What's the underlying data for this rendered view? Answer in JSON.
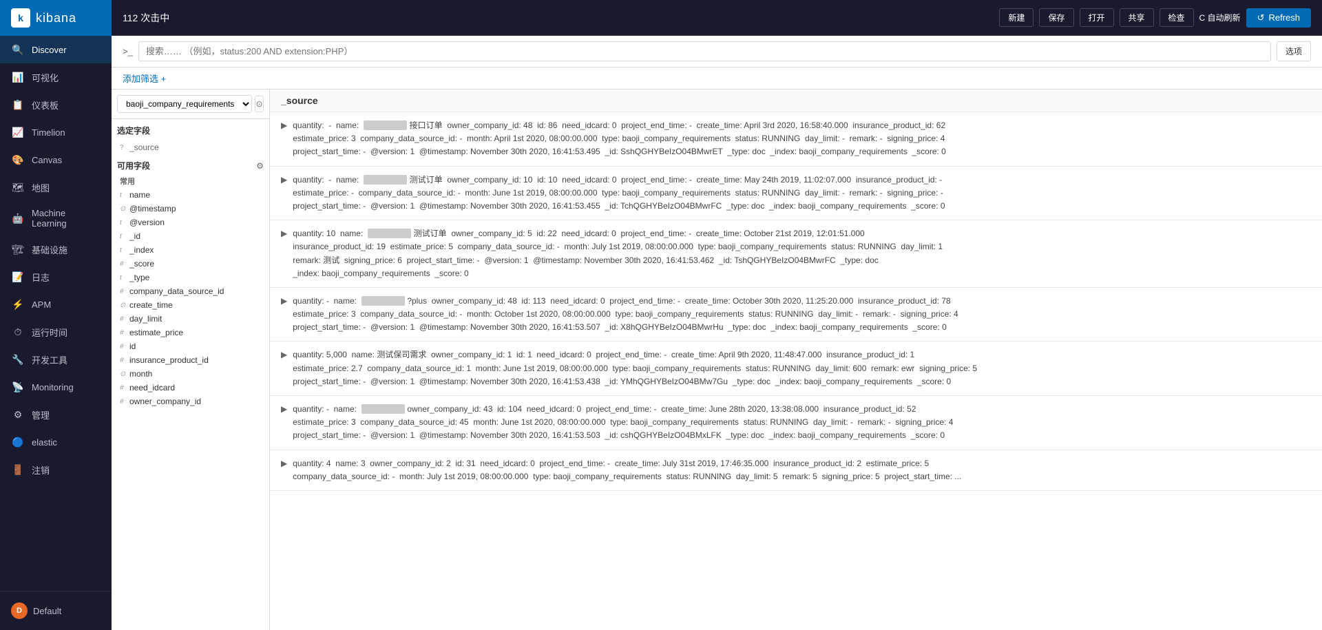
{
  "app": {
    "logo_text": "kibana",
    "logo_initial": "k"
  },
  "sidebar": {
    "items": [
      {
        "id": "discover",
        "label": "Discover",
        "icon": "🔍",
        "active": true
      },
      {
        "id": "visualize",
        "label": "可视化",
        "icon": "📊"
      },
      {
        "id": "dashboard",
        "label": "仪表板",
        "icon": "📋"
      },
      {
        "id": "timelion",
        "label": "Timelion",
        "icon": "📈"
      },
      {
        "id": "canvas",
        "label": "Canvas",
        "icon": "🎨"
      },
      {
        "id": "maps",
        "label": "地图",
        "icon": "🗺"
      },
      {
        "id": "ml",
        "label": "Machine Learning",
        "icon": "🤖"
      },
      {
        "id": "infra",
        "label": "基础设施",
        "icon": "🏗"
      },
      {
        "id": "logs",
        "label": "日志",
        "icon": "📝"
      },
      {
        "id": "apm",
        "label": "APM",
        "icon": "⚡"
      },
      {
        "id": "uptime",
        "label": "运行时间",
        "icon": "⏱"
      },
      {
        "id": "devtools",
        "label": "开发工具",
        "icon": "🔧"
      },
      {
        "id": "monitoring",
        "label": "Monitoring",
        "icon": "📡"
      },
      {
        "id": "management",
        "label": "管理",
        "icon": "⚙"
      },
      {
        "id": "elastic",
        "label": "elastic",
        "icon": "🔵"
      }
    ],
    "bottom_item": {
      "label": "注销",
      "icon": "🚪"
    },
    "user": {
      "label": "Default",
      "initial": "D"
    }
  },
  "topbar": {
    "hit_count": "112 次击中",
    "btn_new": "新建",
    "btn_save": "保存",
    "btn_open": "打开",
    "btn_share": "共享",
    "btn_inspect": "检查",
    "btn_autorefresh": "C 自动刷新",
    "btn_refresh": "Refresh"
  },
  "searchbar": {
    "prompt": ">_",
    "placeholder": "搜索…… （例如，status:200 AND extension:PHP）",
    "btn_options": "选项"
  },
  "filterbar": {
    "add_filter_label": "添加筛选 +"
  },
  "left_panel": {
    "index_pattern": "baoji_company_requirements",
    "selected_fields_label": "选定字段",
    "source_field": "_source",
    "available_fields_label": "可用字段",
    "categories": [
      {
        "label": "常用",
        "fields": [
          {
            "type": "t",
            "name": "name"
          },
          {
            "type": "⊙",
            "name": "@timestamp"
          },
          {
            "type": "t",
            "name": "@version"
          },
          {
            "type": "t",
            "name": "_id"
          },
          {
            "type": "t",
            "name": "_index"
          },
          {
            "type": "#",
            "name": "_score"
          },
          {
            "type": "t",
            "name": "_type"
          },
          {
            "type": "#",
            "name": "company_data_source_id"
          },
          {
            "type": "⊙",
            "name": "create_time"
          },
          {
            "type": "#",
            "name": "day_limit"
          },
          {
            "type": "#",
            "name": "estimate_price"
          },
          {
            "type": "#",
            "name": "id"
          },
          {
            "type": "#",
            "name": "insurance_product_id"
          },
          {
            "type": "⊙",
            "name": "month"
          },
          {
            "type": "#",
            "name": "need_idcard"
          },
          {
            "type": "#",
            "name": "owner_company_id"
          }
        ]
      }
    ]
  },
  "results": {
    "source_label": "_source",
    "rows": [
      {
        "content": "quantity:  -  name:  ████████████接口订单  owner_company_id: 48  id: 86  need_idcard: 0  project_end_time:  -  create_time: April 3rd 2020, 16:58:40.000  insurance_product_id: 62  estimate_price: 3  company_data_source_id:  -  month: April 1st 2020, 08:00:00.000  type: baoji_company_requirements  status: RUNNING  day_limit:  -  remark:  -  signing_price: 4  project_start_time:  -  @version: 1  @timestamp: November 30th 2020, 16:41:53.495  _id: SshQGHYBeIzO04BMwrET  _type: doc  _index: baoji_company_requirements  _score: 0"
      },
      {
        "content": "quantity:  -  name:  ████████████测试订单  owner_company_id: 10  id: 10  need_idcard: 0  project_end_time:  -  create_time: May 24th 2019, 11:02:07.000  insurance_product_id:  -  estimate_price:  -  company_data_source_id:  -  month: June 1st 2019, 08:00:00.000  type: baoji_company_requirements  status: RUNNING  day_limit:  -  remark:  -  signing_price:  -  project_start_time:  -  @version: 1  @timestamp: November 30th 2020, 16:41:53.455  _id: TchQGHYBeIzO04BMwrFC  _type: doc  _index: baoji_company_requirements  _score: 0"
      },
      {
        "content": "quantity: 10  name:  ████████████测试订单  owner_company_id: 5  id: 22  need_idcard: 0  project_end_time:  -  create_time: October 21st 2019, 12:01:51.000  insurance_product_id: 19  estimate_price: 5  company_data_source_id:  -  month: July 1st 2019, 08:00:00.000  type: baoji_company_requirements  status: RUNNING  day_limit: 1  remark: 测试  signing_price: 6  project_start_time:  -  @version: 1  @timestamp: November 30th 2020, 16:41:53.462  _id: TshQGHYBeIzO04BMwrFC  _type: doc  _index: baoji_company_requirements  _score: 0"
      },
      {
        "content": "quantity:  -  name:  ████████████?plus  owner_company_id: 48  id: 113  need_idcard: 0  project_end_time:  -  create_time: October 30th 2020, 11:25:20.000  insurance_product_id: 78  estimate_price: 3  company_data_source_id:  -  month: October 1st 2020, 08:00:00.000  type: baoji_company_requirements  status: RUNNING  day_limit:  -  remark:  -  signing_price: 4  project_start_time:  -  @version: 1  @timestamp: November 30th 2020, 16:41:53.507  _id: X8hQGHYBeIzO04BMwrHu  _type: doc  _index: baoji_company_requirements  _score: 0"
      },
      {
        "content": "quantity: 5,000  name: 测试保司需求  owner_company_id: 1  id: 1  need_idcard: 0  project_end_time:  -  create_time: April 9th 2020, 11:48:47.000  insurance_product_id: 1  estimate_price: 2.7  company_data_source_id: 1  month: June 1st 2019, 08:00:00.000  type: baoji_company_requirements  status: RUNNING  day_limit: 600  remark: ewr  signing_price: 5  project_start_time:  -  @version: 1  @timestamp: November 30th 2020, 16:41:53.438  _id: YMhQGHYBeIzO04BMw7Gu  _type: doc  _index: baoji_company_requirements  _score: 0"
      },
      {
        "content": "quantity:  -  name:  ████████████  owner_company_id: 43  id: 104  need_idcard: 0  project_end_time:  -  create_time: June 28th 2020, 13:38:08.000  insurance_product_id: 52  estimate_price: 3  company_data_source_id: 45  month: June 1st 2020, 08:00:00.000  type: baoji_company_requirements  status: RUNNING  day_limit:  -  remark:  -  signing_price: 4  project_start_time:  -  @version: 1  @timestamp: November 30th 2020, 16:41:53.503  _id: cshQGHYBeIzO04BMxLFK  _type: doc  _index: baoji_company_requirements  _score: 0"
      },
      {
        "content": "quantity: 4  name: 3  owner_company_id: 2  id: 31  need_idcard: 0  project_end_time:  -  create_time: July 31st 2019, 17:46:35.000  insurance_product_id: 2  estimate_price: 5  company_data_source_id:  -  month: July 1st 2019, 08:00:00.000  type: baoji_company_requirements  status: RUNNING  day_limit: 5  remark: 5  signing_price: 5  project_start_time: ..."
      }
    ]
  }
}
